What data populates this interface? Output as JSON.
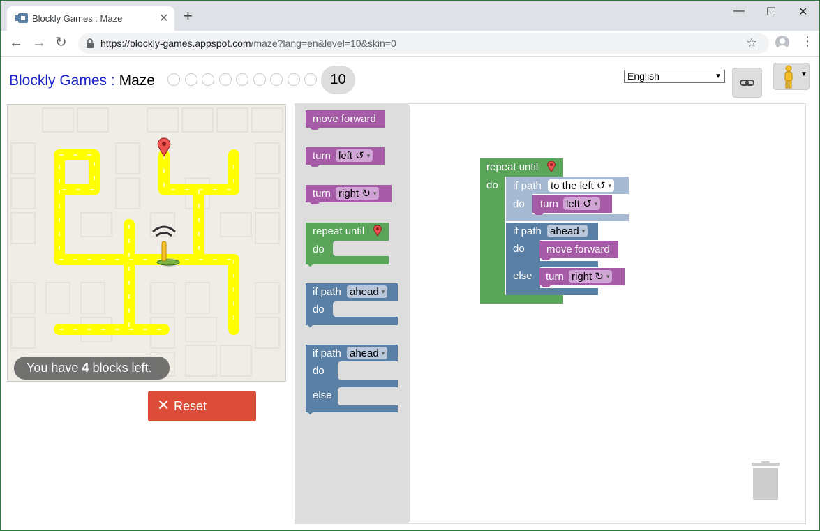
{
  "browser": {
    "tab_title": "Blockly Games : Maze",
    "tab_close": "✕",
    "new_tab": "+",
    "url_host": "https://blockly-games.appspot.com",
    "url_path": "/maze?lang=en&level=10&skin=0",
    "back": "←",
    "forward": "→",
    "reload": "↻",
    "star": "☆",
    "menu": "⋮",
    "minimize": "—",
    "maximize": "☐",
    "close": "✕"
  },
  "header": {
    "brand": "Blockly Games",
    "separator": ":",
    "game": "Maze",
    "current_level": "10",
    "completed_levels": 9,
    "language": "English",
    "language_arrow": "▼",
    "pegman_arrow": "▼"
  },
  "maze": {
    "capacity_pre": "You have ",
    "capacity_num": "4",
    "capacity_post": " blocks left.",
    "reset_icon": "✕",
    "reset_label": "Reset"
  },
  "toolbox": {
    "move_forward": "move forward",
    "turn": "turn",
    "left": "left ↺",
    "right": "right ↻",
    "repeat_until": "repeat until",
    "do": "do",
    "if_path": "if path",
    "ahead": "ahead",
    "else": "else",
    "dd_arrow": "▾"
  },
  "program": {
    "repeat_until": "repeat until",
    "do": "do",
    "if_path_1": "if path",
    "to_the_left": "to the left ↺",
    "do_1": "do",
    "turn_1": "turn",
    "left": "left ↺",
    "if_path_2": "if path",
    "ahead": "ahead",
    "do_2": "do",
    "move_forward": "move forward",
    "else": "else",
    "turn_2": "turn",
    "right": "right ↻"
  },
  "colors": {
    "motion": "#a55ba5",
    "loop": "#5ba55b",
    "logic": "#5b80a5",
    "selected": "#a7bad3",
    "path": "#ffff00",
    "reset": "#dd4b39"
  }
}
